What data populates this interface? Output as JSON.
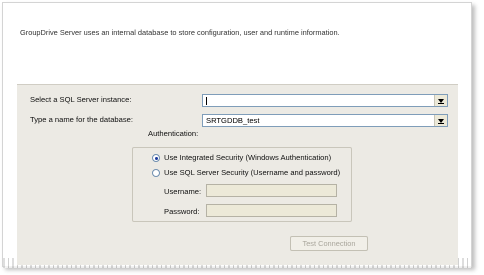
{
  "intro_text": "GroupDrive Server uses an internal database to store configuration, user and runtime information.",
  "sql_instance": {
    "label": "Select a SQL Server instance:",
    "value": ""
  },
  "database_name": {
    "label": "Type a name for the database:",
    "value": "SRTGDDB_test"
  },
  "authentication": {
    "legend": "Authentication:",
    "options": [
      {
        "label": "Use Integrated Security (Windows Authentication)",
        "selected": true
      },
      {
        "label": "Use SQL Server Security (Username and password)",
        "selected": false
      }
    ],
    "username_label": "Username:",
    "username_value": "",
    "password_label": "Password:",
    "password_value": ""
  },
  "test_connection_label": "Test Connection",
  "colors": {
    "form_background": "#eceae4",
    "input_border": "#7f9db9",
    "disabled_text": "#a9a69c"
  }
}
